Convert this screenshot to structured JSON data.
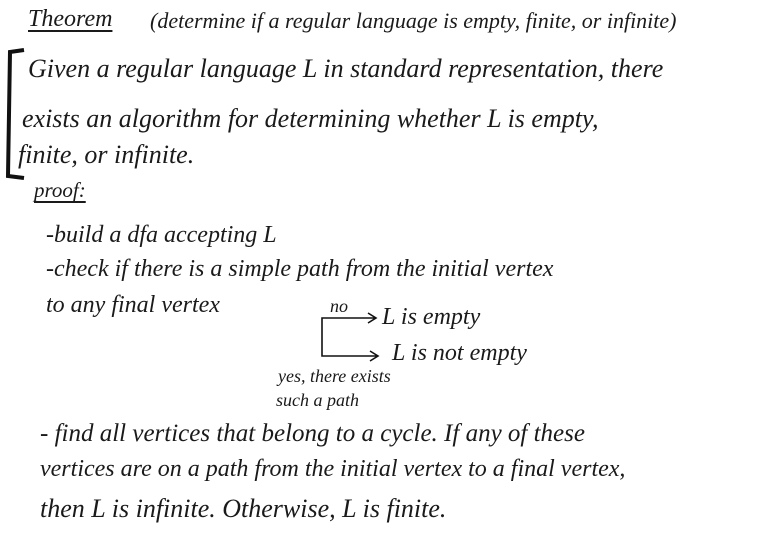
{
  "theorem": {
    "label": "Theorem",
    "subtitle": "(determine if a regular language is empty, finite, or infinite)",
    "statement": [
      "Given a regular language L in standard representation, there",
      "exists an algorithm for determining whether L is empty,",
      "finite, or infinite."
    ]
  },
  "proof": {
    "label": "proof:",
    "steps": [
      "-build a dfa accepting L",
      "-check if there is a simple path from the initial vertex",
      "to any final vertex"
    ],
    "branch": {
      "no_label": "no",
      "no_result": "L is empty",
      "yes_result": "L is not empty",
      "yes_label_1": "yes, there exists",
      "yes_label_2": "such a path"
    },
    "final": [
      "- find all vertices that belong to a cycle. If any of these",
      "vertices are on a path from the initial vertex to a final vertex,",
      "then L is infinite. Otherwise, L is finite."
    ]
  }
}
